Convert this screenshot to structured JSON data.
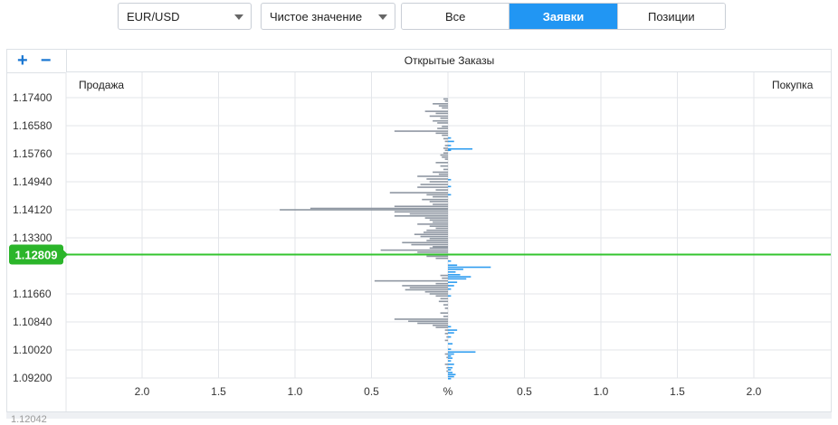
{
  "toolbar": {
    "pair_select": "EUR/USD",
    "mode_select": "Чистое значение",
    "tabs": [
      "Все",
      "Заявки",
      "Позиции"
    ],
    "active_tab": 1
  },
  "header": {
    "title": "Открытые Заказы",
    "zoom_in": "+",
    "zoom_out": "−"
  },
  "chart_data": {
    "type": "bar",
    "orientation": "horizontal",
    "title": "Открытые Заказы",
    "left_label": "Продажа",
    "right_label": "Покупка",
    "y_ticks": [
      "1.17400",
      "1.16580",
      "1.15760",
      "1.14940",
      "1.14120",
      "1.13300",
      "1.11660",
      "1.10840",
      "1.10020",
      "1.09200"
    ],
    "x_ticks": [
      "2.0",
      "1.5",
      "1.0",
      "0.5",
      "%",
      "0.5",
      "1.0",
      "1.5",
      "2.0"
    ],
    "x_range": [
      -2.5,
      2.5
    ],
    "y_range": [
      1.092,
      1.174
    ],
    "current_price": "1.12809",
    "sell": [
      [
        1.1736,
        0.03
      ],
      [
        1.173,
        0.02
      ],
      [
        1.1722,
        0.1
      ],
      [
        1.1716,
        0.06
      ],
      [
        1.171,
        0.04
      ],
      [
        1.17,
        0.15
      ],
      [
        1.1694,
        0.08
      ],
      [
        1.1686,
        0.12
      ],
      [
        1.168,
        0.05
      ],
      [
        1.1672,
        0.1
      ],
      [
        1.1666,
        0.07
      ],
      [
        1.1656,
        0.04
      ],
      [
        1.165,
        0.07
      ],
      [
        1.1642,
        0.35
      ],
      [
        1.1636,
        0.08
      ],
      [
        1.163,
        0.04
      ],
      [
        1.162,
        0.03
      ],
      [
        1.1612,
        0.02
      ],
      [
        1.16,
        0.02
      ],
      [
        1.1592,
        0.03
      ],
      [
        1.1586,
        0.02
      ],
      [
        1.1578,
        0.03
      ],
      [
        1.1572,
        0.05
      ],
      [
        1.1566,
        0.04
      ],
      [
        1.156,
        0.02
      ],
      [
        1.155,
        0.08
      ],
      [
        1.154,
        0.05
      ],
      [
        1.153,
        0.03
      ],
      [
        1.1522,
        0.1
      ],
      [
        1.1516,
        0.06
      ],
      [
        1.151,
        0.2
      ],
      [
        1.1502,
        0.14
      ],
      [
        1.1494,
        0.12
      ],
      [
        1.1486,
        0.18
      ],
      [
        1.1478,
        0.2
      ],
      [
        1.147,
        0.08
      ],
      [
        1.1462,
        0.38
      ],
      [
        1.1456,
        0.14
      ],
      [
        1.145,
        0.1
      ],
      [
        1.1442,
        0.17
      ],
      [
        1.1436,
        0.12
      ],
      [
        1.1428,
        0.1
      ],
      [
        1.1422,
        0.35
      ],
      [
        1.1416,
        0.9
      ],
      [
        1.1412,
        1.1
      ],
      [
        1.1406,
        0.35
      ],
      [
        1.14,
        0.25
      ],
      [
        1.1394,
        0.35
      ],
      [
        1.1388,
        0.15
      ],
      [
        1.1382,
        0.12
      ],
      [
        1.1376,
        0.1
      ],
      [
        1.137,
        0.2
      ],
      [
        1.1364,
        0.12
      ],
      [
        1.1358,
        0.08
      ],
      [
        1.1352,
        0.14
      ],
      [
        1.1346,
        0.16
      ],
      [
        1.134,
        0.22
      ],
      [
        1.1334,
        0.18
      ],
      [
        1.1328,
        0.12
      ],
      [
        1.1322,
        0.14
      ],
      [
        1.1316,
        0.3
      ],
      [
        1.131,
        0.24
      ],
      [
        1.1304,
        0.1
      ],
      [
        1.13,
        0.12
      ],
      [
        1.1294,
        0.44
      ],
      [
        1.1288,
        0.2
      ],
      [
        1.1282,
        0.22
      ],
      [
        1.1276,
        0.14
      ],
      [
        1.127,
        0.08
      ],
      [
        1.122,
        0.05
      ],
      [
        1.1212,
        0.04
      ],
      [
        1.1204,
        0.48
      ],
      [
        1.1196,
        0.08
      ],
      [
        1.119,
        0.3
      ],
      [
        1.1184,
        0.25
      ],
      [
        1.1178,
        0.28
      ],
      [
        1.1172,
        0.15
      ],
      [
        1.1166,
        0.12
      ],
      [
        1.116,
        0.08
      ],
      [
        1.1152,
        0.05
      ],
      [
        1.1144,
        0.06
      ],
      [
        1.1134,
        0.03
      ],
      [
        1.1124,
        0.02
      ],
      [
        1.111,
        0.05
      ],
      [
        1.11,
        0.03
      ],
      [
        1.1092,
        0.35
      ],
      [
        1.1086,
        0.26
      ],
      [
        1.108,
        0.2
      ],
      [
        1.1074,
        0.1
      ],
      [
        1.1068,
        0.08
      ],
      [
        1.106,
        0.02
      ],
      [
        1.105,
        0.02
      ],
      [
        1.104,
        0.01
      ],
      [
        1.103,
        0.02
      ],
      [
        1.099,
        0.02
      ],
      [
        1.098,
        0.01
      ],
      [
        1.096,
        0.02
      ],
      [
        1.095,
        0.01
      ],
      [
        1.094,
        0.01
      ]
    ],
    "buy": [
      [
        1.1622,
        0.02
      ],
      [
        1.1612,
        0.04
      ],
      [
        1.16,
        0.02
      ],
      [
        1.159,
        0.16
      ],
      [
        1.1586,
        0.02
      ],
      [
        1.15,
        0.02
      ],
      [
        1.148,
        0.02
      ],
      [
        1.1456,
        0.02
      ],
      [
        1.1262,
        0.02
      ],
      [
        1.125,
        0.06
      ],
      [
        1.1244,
        0.28
      ],
      [
        1.1238,
        0.1
      ],
      [
        1.123,
        0.05
      ],
      [
        1.1222,
        0.08
      ],
      [
        1.1216,
        0.15
      ],
      [
        1.121,
        0.12
      ],
      [
        1.12,
        0.06
      ],
      [
        1.119,
        0.04
      ],
      [
        1.118,
        0.02
      ],
      [
        1.116,
        0.02
      ],
      [
        1.107,
        0.02
      ],
      [
        1.106,
        0.06
      ],
      [
        1.1052,
        0.04
      ],
      [
        1.104,
        0.02
      ],
      [
        1.102,
        0.03
      ],
      [
        1.1004,
        0.02
      ],
      [
        1.0996,
        0.18
      ],
      [
        1.099,
        0.04
      ],
      [
        1.0984,
        0.02
      ],
      [
        1.0978,
        0.03
      ],
      [
        1.097,
        0.02
      ],
      [
        1.096,
        0.04
      ],
      [
        1.095,
        0.03
      ],
      [
        1.0944,
        0.02
      ],
      [
        1.0936,
        0.03
      ],
      [
        1.093,
        0.05
      ],
      [
        1.0924,
        0.04
      ],
      [
        1.0918,
        0.02
      ]
    ],
    "colors": {
      "sell": "#8f97a2",
      "buy": "#2f9df0",
      "price_line": "#34c42f",
      "price_badge": "#2bb52a",
      "grid": "#e3e6ea"
    },
    "grid": true
  },
  "footer": {
    "partial_label": "1.12042"
  }
}
